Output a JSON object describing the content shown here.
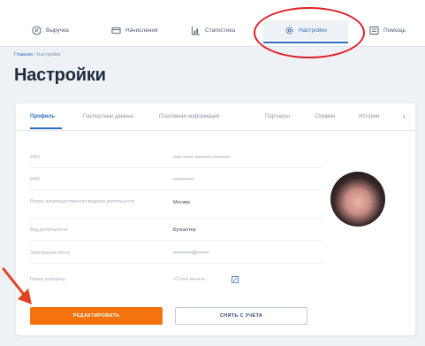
{
  "nav": {
    "items": [
      {
        "label": "Выручка",
        "icon": "revenue-icon"
      },
      {
        "label": "Начисления",
        "icon": "accruals-icon"
      },
      {
        "label": "Статистика",
        "icon": "statistics-icon"
      },
      {
        "label": "Настройки",
        "icon": "gear-icon",
        "active": true
      },
      {
        "label": "Помощь",
        "icon": "help-icon"
      }
    ]
  },
  "breadcrumb": {
    "home": "Главная",
    "separator": " / ",
    "current": "Настройки"
  },
  "page": {
    "title": "Настройки"
  },
  "tabs": [
    {
      "label": "Профиль",
      "active": true
    },
    {
      "label": "Паспортные данные"
    },
    {
      "label": "Платежная информация"
    },
    {
      "label": "Партнеры"
    },
    {
      "label": "Справки"
    },
    {
      "label": "Истории"
    }
  ],
  "tabs_more_glyph": "›",
  "profile": {
    "fields": [
      {
        "label": "ФИО",
        "value": "••••• •••••• •••••••••• ••••••••••"
      },
      {
        "label": "ИНН",
        "value": "••••••••••••"
      },
      {
        "label": "Регион преимущественного ведения деятельности",
        "value": "Москва"
      },
      {
        "label": "Вид деятельности",
        "value": "Бухгалтер"
      },
      {
        "label": "Электронная почта",
        "value": "•••••••••••@•••••••"
      },
      {
        "label": "Номер телефона",
        "value": "+7 (•••) •••-••-••"
      }
    ]
  },
  "actions": {
    "edit_label": "РЕДАКТИРОВАТЬ",
    "deregister_label": "СНЯТЬ С УЧЕТА"
  },
  "colors": {
    "accent": "#2f6fc0",
    "primary_button": "#f5730f",
    "highlight": "#e01f25",
    "background": "#eef1f5"
  }
}
